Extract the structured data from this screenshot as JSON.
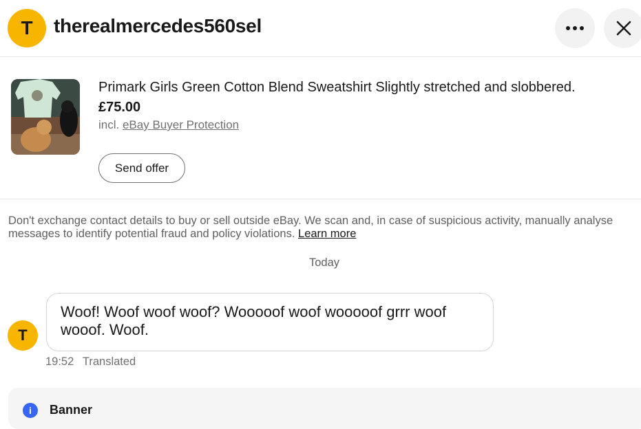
{
  "header": {
    "avatar_letter": "T",
    "username": "therealmercedes560sel",
    "more_icon": "more-horizontal-icon",
    "close_icon": "close-icon"
  },
  "listing": {
    "title": "Primark Girls Green Cotton Blend Sweatshirt Slightly stretched and slobbered.",
    "price": "£75.00",
    "protection_prefix": "incl.",
    "protection_link": "eBay Buyer Protection",
    "offer_button": "Send offer"
  },
  "notice": {
    "text": "Don't exchange contact details to buy or sell outside eBay. We scan and, in case of suspicious activity, manually analyse messages to identify potential fraud and policy violations.",
    "link": "Learn more"
  },
  "conversation": {
    "day_label": "Today",
    "messages": [
      {
        "avatar_letter": "T",
        "text": "Woof! Woof woof woof? Wooooof woof wooooof grrr woof wooof. Woof.",
        "time": "19:52",
        "status": "Translated"
      }
    ]
  },
  "banner": {
    "icon": "info-icon",
    "title": "Banner"
  },
  "colors": {
    "avatar": "#f7b500",
    "info_blue": "#3665f3"
  }
}
